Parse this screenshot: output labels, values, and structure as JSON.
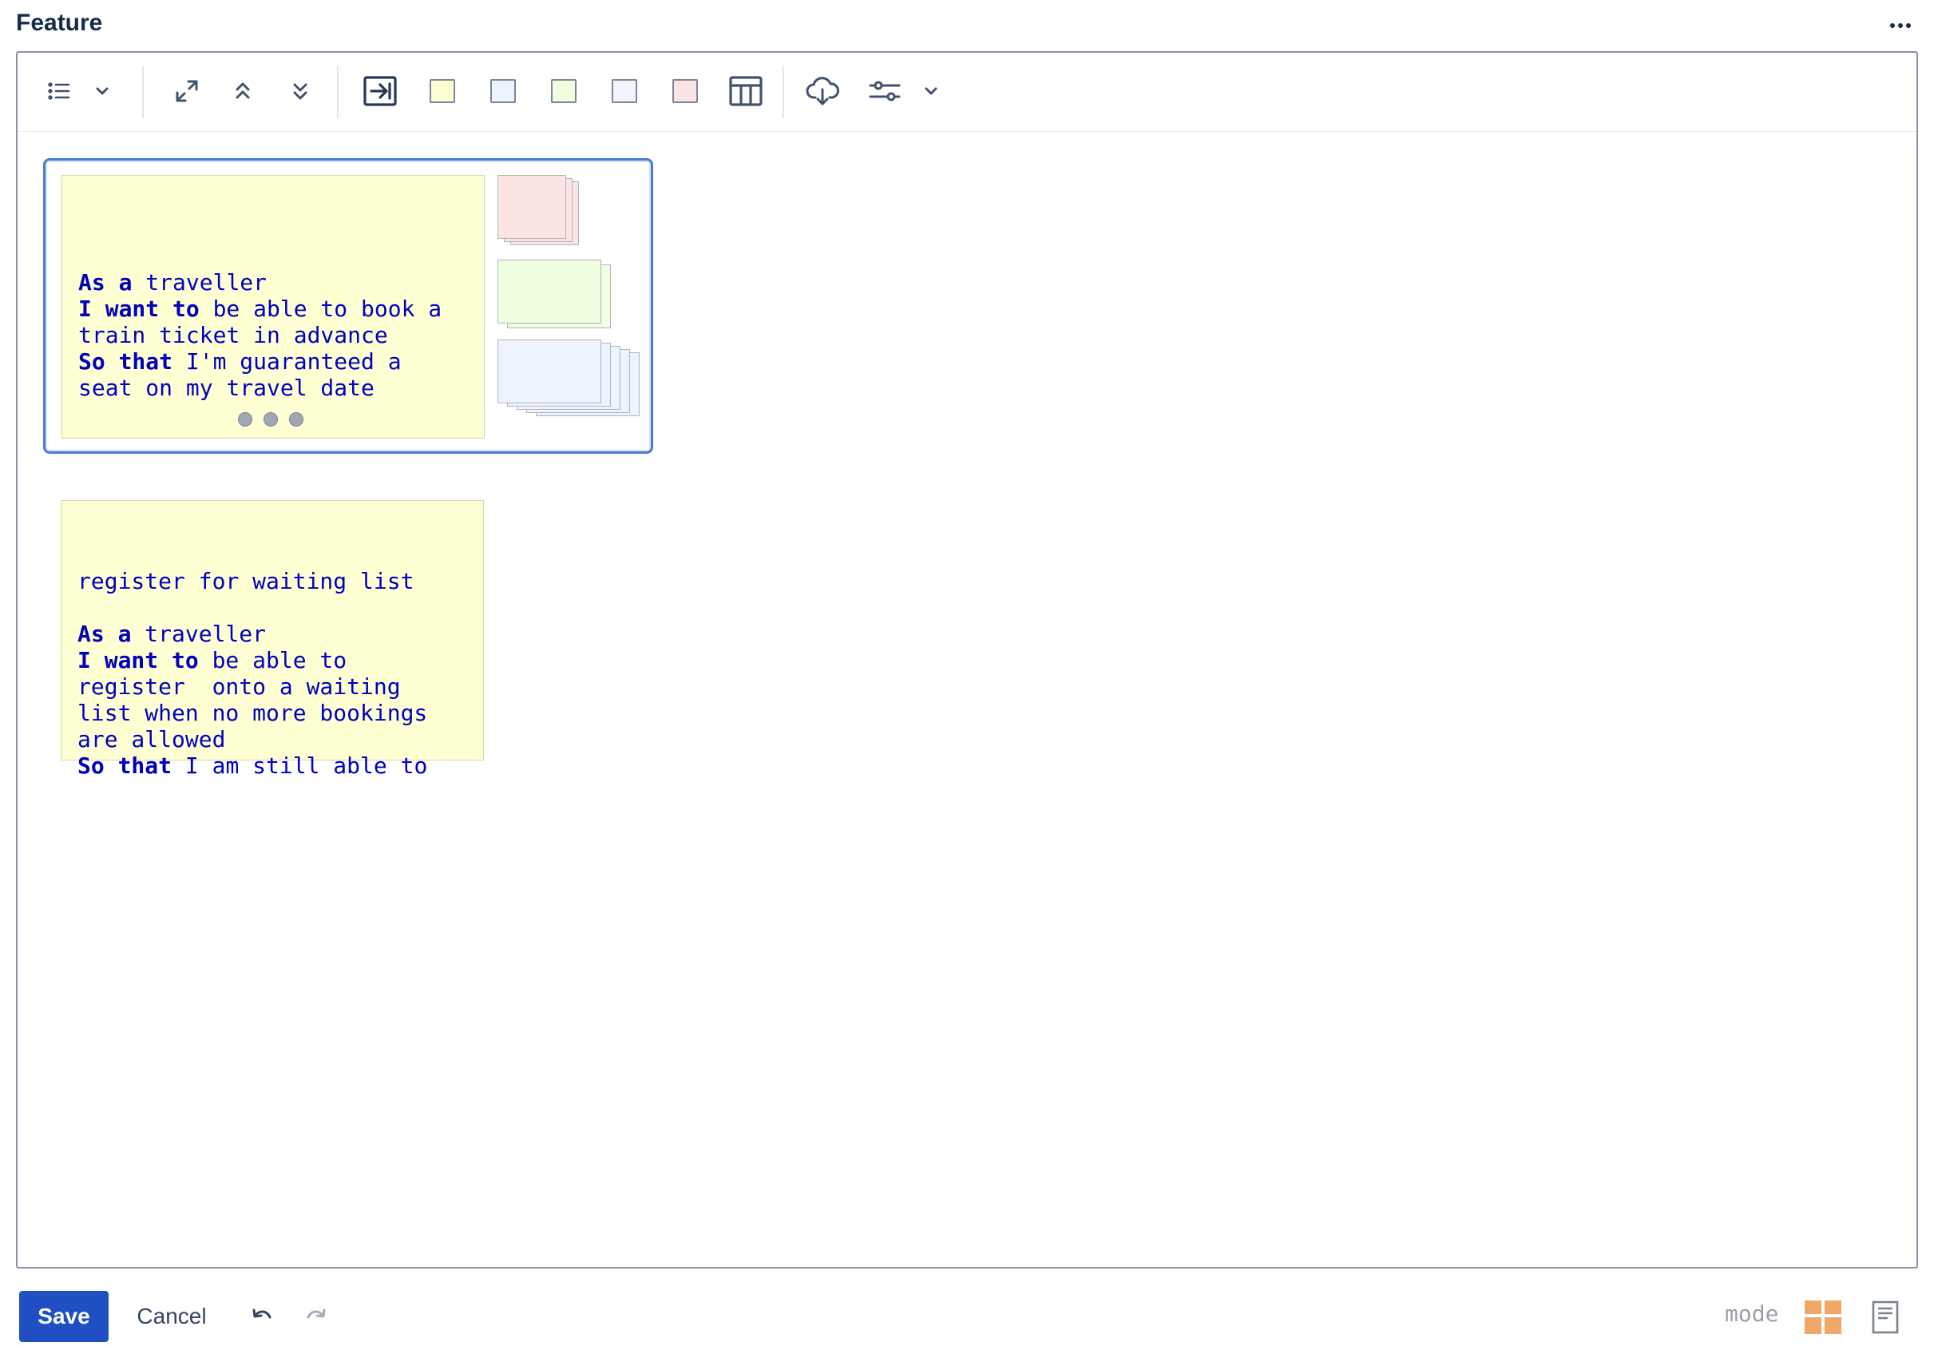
{
  "header": {
    "title": "Feature"
  },
  "toolbar": {
    "items": [
      {
        "icon": "list-icon"
      },
      {
        "icon": "chevron-down-icon"
      },
      {
        "icon": "expand-icon"
      },
      {
        "icon": "chevrons-up-icon"
      },
      {
        "icon": "chevrons-down-icon"
      },
      {
        "icon": "insert-card-icon"
      },
      {
        "icon": "swatch-yellow",
        "color": "#ffffd4"
      },
      {
        "icon": "swatch-blue",
        "color": "#eef4ff"
      },
      {
        "icon": "swatch-green",
        "color": "#efffe0"
      },
      {
        "icon": "swatch-lavender",
        "color": "#f3f3fb"
      },
      {
        "icon": "swatch-pink",
        "color": "#fbe4e2"
      },
      {
        "icon": "table-icon"
      },
      {
        "icon": "cloud-download-icon"
      },
      {
        "icon": "sliders-icon"
      },
      {
        "icon": "chevron-down-icon"
      }
    ]
  },
  "cards": [
    {
      "lines": [
        {
          "kw": "",
          "text": ""
        },
        {
          "kw": "As a",
          "text": " traveller"
        },
        {
          "kw": "I want to",
          "text": " be able to book a"
        },
        {
          "kw": "",
          "text": "train ticket in advance"
        },
        {
          "kw": "So that",
          "text": " I'm guaranteed a"
        },
        {
          "kw": "",
          "text": "seat on my travel date"
        }
      ],
      "color": "#ffffd4"
    },
    {
      "lines": [
        {
          "kw": "",
          "text": "register for waiting list"
        },
        {
          "kw": "",
          "text": ""
        },
        {
          "kw": "As a",
          "text": " traveller"
        },
        {
          "kw": "I want to",
          "text": " be able to"
        },
        {
          "kw": "",
          "text": "register  onto a waiting"
        },
        {
          "kw": "",
          "text": "list when no more bookings"
        },
        {
          "kw": "",
          "text": "are allowed"
        },
        {
          "kw": "So that",
          "text": " I am still able to"
        }
      ],
      "color": "#ffffd4"
    }
  ],
  "stacks": [
    {
      "color": "#fbe4e2",
      "name": "pink-card-stack"
    },
    {
      "color": "#efffe0",
      "name": "green-card-stack"
    },
    {
      "color": "#eef4ff",
      "name": "blue-card-stack"
    }
  ],
  "footer": {
    "save_label": "Save",
    "cancel_label": "Cancel",
    "mode_label": "mode",
    "accent": "#1f4fc2",
    "mode_color": "#f0a868"
  }
}
